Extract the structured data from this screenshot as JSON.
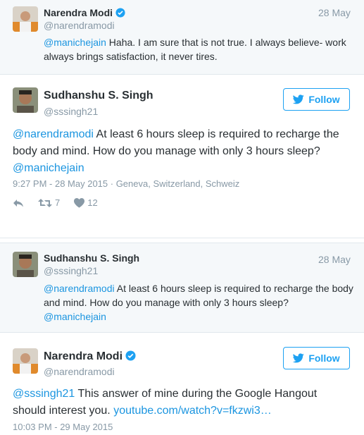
{
  "tweets": [
    {
      "name": "Narendra Modi",
      "handle": "@narendramodi",
      "date": "28 May",
      "verified": true,
      "mention": "@manichejain",
      "text": " Haha. I am sure that is not true. I always believe- work always brings satisfaction, it never tires."
    },
    {
      "name": "Sudhanshu S. Singh",
      "handle": "@sssingh21",
      "follow_label": "Follow",
      "mention": "@narendramodi",
      "text": " At least 6 hours sleep is required to recharge the body and mind. How do you manage with only 3 hours sleep? ",
      "mention2": "@manichejain",
      "timestamp": "9:27 PM - 28 May 2015",
      "location": " · Geneva, Switzerland, Schweiz",
      "retweets": "7",
      "likes": "12"
    },
    {
      "name": "Sudhanshu S. Singh",
      "handle": "@sssingh21",
      "date": "28 May",
      "mention": "@narendramodi",
      "text": " At least 6 hours sleep is required to recharge the body and mind. How do you manage with only 3 hours sleep? ",
      "mention2": "@manichejain"
    },
    {
      "name": "Narendra Modi",
      "handle": "@narendramodi",
      "verified": true,
      "follow_label": "Follow",
      "mention": "@sssingh21",
      "text": " This answer of mine during the Google Hangout should interest you. ",
      "url": "youtube.com/watch?v=fkzwi3…",
      "timestamp": "10:03 PM - 29 May 2015"
    }
  ],
  "colors": {
    "link": "#1b95e0",
    "follow": "#1da1f2",
    "muted": "#8899a6",
    "verified": "#1da1f2"
  },
  "icons": [
    "verified-badge-icon",
    "twitter-bird-icon",
    "reply-icon",
    "retweet-icon",
    "heart-icon"
  ]
}
